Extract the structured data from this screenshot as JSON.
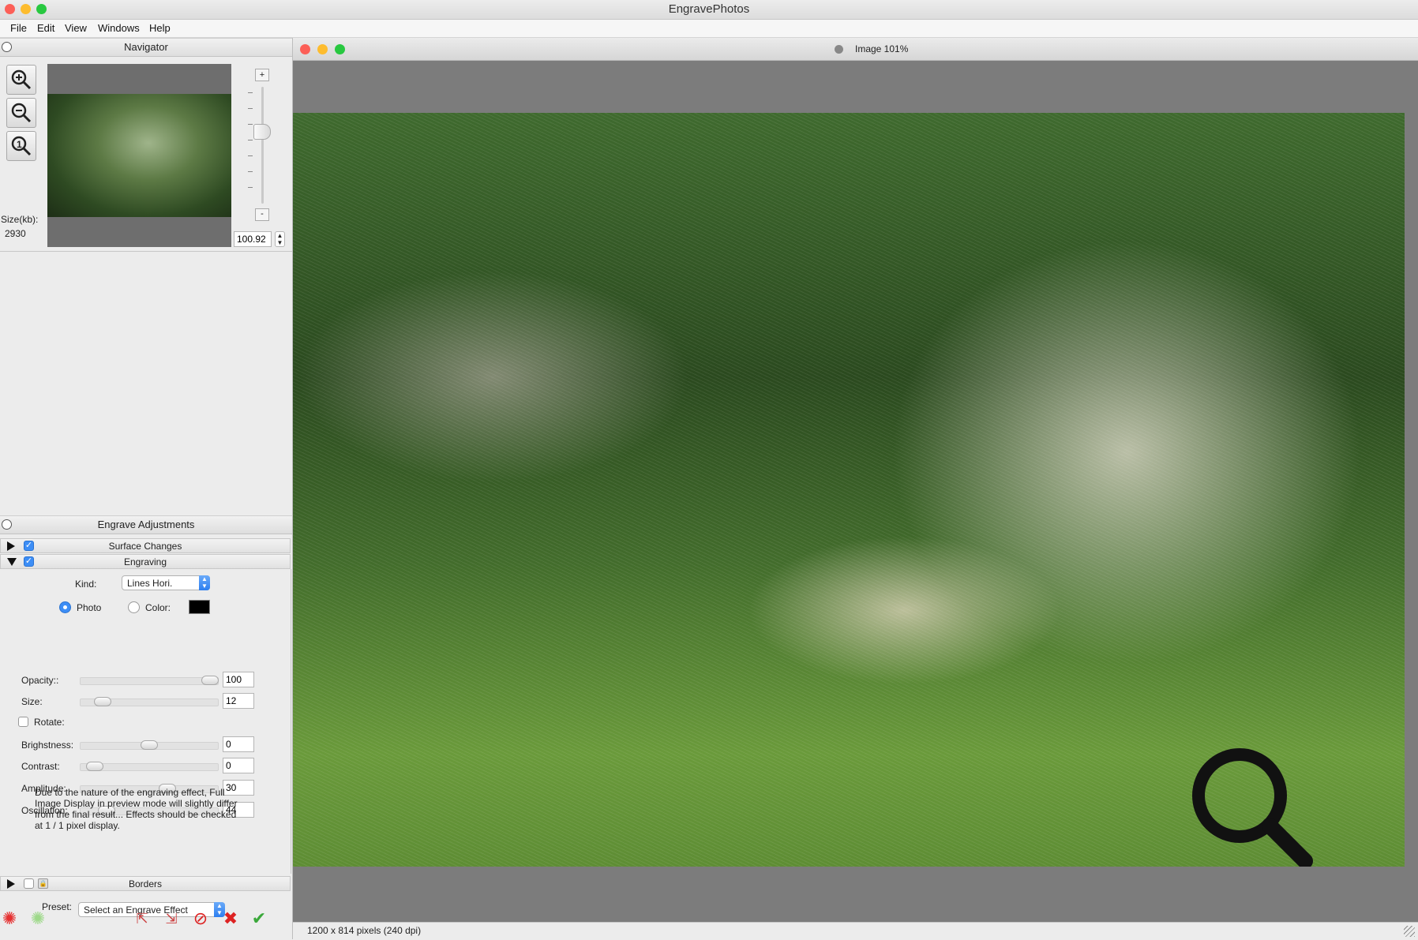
{
  "app": {
    "title": "EngravePhotos"
  },
  "menu": [
    "File",
    "Edit",
    "View",
    "Windows",
    "Help"
  ],
  "colors": {
    "accent": "#3d8ef6",
    "close": "#fc5f57",
    "minimize": "#fdbc2e",
    "zoom": "#28c840"
  },
  "navigator": {
    "title": "Navigator",
    "size_label": "Size(kb):",
    "size_value": "2930",
    "zoom_value": "100.92",
    "zoom_plus": "+",
    "zoom_minus": "-",
    "tools": [
      "zoom-in-icon",
      "zoom-out-icon",
      "actual-size-icon"
    ]
  },
  "adjustments": {
    "title": "Engrave Adjustments",
    "sections": {
      "surface": {
        "label": "Surface Changes",
        "enabled": true
      },
      "engraving": {
        "label": "Engraving",
        "enabled": true
      },
      "borders": {
        "label": "Borders",
        "enabled": false
      }
    },
    "kind": {
      "label": "Kind:",
      "value": "Lines Hori."
    },
    "photo_label": "Photo",
    "color_label": "Color:",
    "color_swatch": "#000000",
    "rotate_label": "Rotate:",
    "sliders": [
      {
        "label": "Opacity::",
        "value": "100",
        "level": 1.0
      },
      {
        "label": "Size:",
        "value": "12",
        "level": 0.12
      },
      {
        "label": "Brighstness:",
        "value": "0",
        "level": 0.5
      },
      {
        "label": "Contrast:",
        "value": "0",
        "level": 0.05
      },
      {
        "label": "Amplitude:",
        "value": "30",
        "level": 0.65
      },
      {
        "label": "Oscillation:",
        "value": "44",
        "level": 0.15
      }
    ],
    "note": "Due to the nature of the engraving effect, Full Image Display in preview mode will slightly differ from the final result... Effects should  be checked at 1 / 1 pixel display.",
    "preset_label": "Preset:",
    "preset_value": "Select an Engrave Effect"
  },
  "image_window": {
    "title": "Image 101%",
    "status": "1200 x 814 pixels (240 dpi)"
  }
}
